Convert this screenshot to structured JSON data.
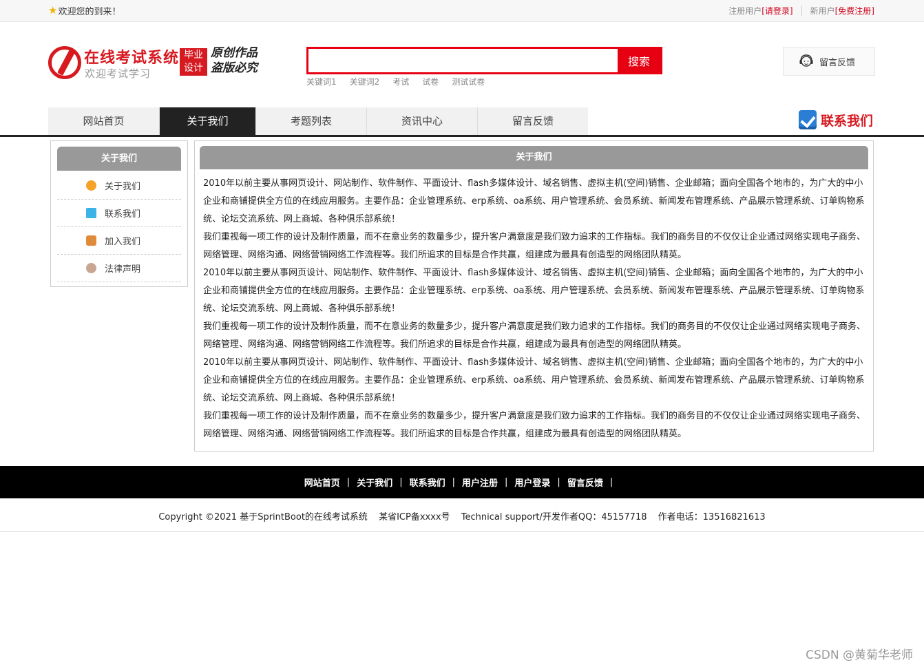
{
  "topbar": {
    "welcome": "欢迎您的到来！",
    "registered_label": "注册用户",
    "login_link": "[请登录]",
    "new_user_label": "新用户",
    "register_link": "[免费注册]"
  },
  "header": {
    "site_title": "在线考试系统",
    "site_subtitle": "欢迎考试学习",
    "badge_line1": "毕业",
    "badge_line2": "设计",
    "slogan_line1": "原创作品",
    "slogan_line2": "盗版必究"
  },
  "search": {
    "placeholder": "",
    "button": "搜索",
    "keywords": [
      "关键词1",
      "关键词2",
      "考试",
      "试卷",
      "测试试卷"
    ]
  },
  "feedback_button": "留言反馈",
  "nav": {
    "items": [
      {
        "label": "网站首页"
      },
      {
        "label": "关于我们"
      },
      {
        "label": "考题列表"
      },
      {
        "label": "资讯中心"
      },
      {
        "label": "留言反馈"
      }
    ],
    "active_index": 1,
    "contact_label": "联系我们"
  },
  "sidebar": {
    "title": "关于我们",
    "items": [
      {
        "label": "关于我们",
        "icon": "about-icon"
      },
      {
        "label": "联系我们",
        "icon": "clipboard-icon"
      },
      {
        "label": "加入我们",
        "icon": "lock-icon"
      },
      {
        "label": "法律声明",
        "icon": "power-icon"
      }
    ]
  },
  "main": {
    "title": "关于我们",
    "paragraphs": [
      "2010年以前主要从事网页设计、网站制作、软件制作、平面设计、flash多媒体设计、域名销售、虚拟主机(空间)销售、企业邮箱；面向全国各个地市的，为广大的中小企业和商铺提供全方位的在线应用服务。主要作品：企业管理系统、erp系统、oa系统、用户管理系统、会员系统、新闻发布管理系统、产品展示管理系统、订单购物系统、论坛交流系统、网上商城、各种俱乐部系统！",
      "我们重视每一项工作的设计及制作质量，而不在意业务的数量多少，提升客户满意度是我们致力追求的工作指标。我们的商务目的不仅仅让企业通过网络实现电子商务、网络管理、网络沟通、网络营销网络工作流程等。我们所追求的目标是合作共赢，组建成为最具有创造型的网络团队精英。",
      "2010年以前主要从事网页设计、网站制作、软件制作、平面设计、flash多媒体设计、域名销售、虚拟主机(空间)销售、企业邮箱；面向全国各个地市的，为广大的中小企业和商铺提供全方位的在线应用服务。主要作品：企业管理系统、erp系统、oa系统、用户管理系统、会员系统、新闻发布管理系统、产品展示管理系统、订单购物系统、论坛交流系统、网上商城、各种俱乐部系统！",
      "我们重视每一项工作的设计及制作质量，而不在意业务的数量多少，提升客户满意度是我们致力追求的工作指标。我们的商务目的不仅仅让企业通过网络实现电子商务、网络管理、网络沟通、网络营销网络工作流程等。我们所追求的目标是合作共赢，组建成为最具有创造型的网络团队精英。",
      "2010年以前主要从事网页设计、网站制作、软件制作、平面设计、flash多媒体设计、域名销售、虚拟主机(空间)销售、企业邮箱；面向全国各个地市的，为广大的中小企业和商铺提供全方位的在线应用服务。主要作品：企业管理系统、erp系统、oa系统、用户管理系统、会员系统、新闻发布管理系统、产品展示管理系统、订单购物系统、论坛交流系统、网上商城、各种俱乐部系统！",
      "我们重视每一项工作的设计及制作质量，而不在意业务的数量多少，提升客户满意度是我们致力追求的工作指标。我们的商务目的不仅仅让企业通过网络实现电子商务、网络管理、网络沟通、网络营销网络工作流程等。我们所追求的目标是合作共赢，组建成为最具有创造型的网络团队精英。"
    ]
  },
  "footer": {
    "links": [
      "网站首页",
      "关于我们",
      "联系我们",
      "用户注册",
      "用户登录",
      "留言反馈"
    ],
    "separator": "|",
    "copyright": "Copyright ©2021 基于SprintBoot的在线考试系统",
    "icp": "某省ICP备xxxx号",
    "support": "Technical support/开发作者QQ：45157718",
    "phone": "作者电话：13516821613"
  },
  "watermark": "CSDN @黄菊华老师",
  "colors": {
    "brand_red": "#d71920",
    "search_red": "#e60012",
    "nav_active": "#222222",
    "panel_header": "#999999",
    "footer_bg": "#000000"
  }
}
